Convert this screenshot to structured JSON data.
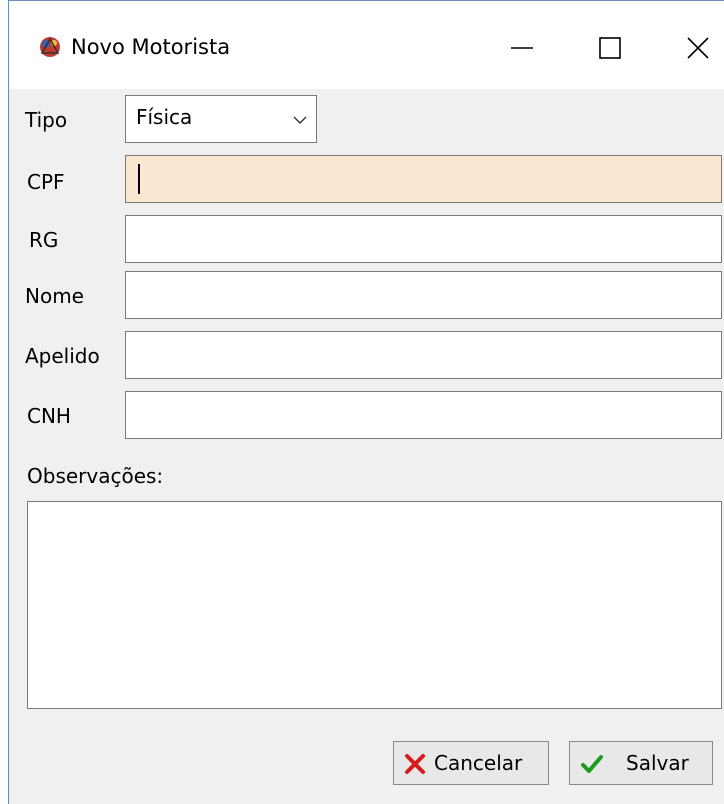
{
  "window": {
    "title": "Novo Motorista",
    "icon": "driver-app-icon",
    "controls": [
      "minimize-icon",
      "maximize-icon",
      "close-icon"
    ]
  },
  "form": {
    "tipo": {
      "label": "Tipo",
      "value": "Física"
    },
    "cpf": {
      "label": "CPF",
      "value": ""
    },
    "rg": {
      "label": "RG",
      "value": ""
    },
    "nome": {
      "label": "Nome",
      "value": ""
    },
    "apelido": {
      "label": "Apelido",
      "value": ""
    },
    "cnh": {
      "label": "CNH",
      "value": ""
    },
    "observacoes": {
      "label": "Observações:",
      "value": ""
    }
  },
  "buttons": {
    "cancel_label": "Cancelar",
    "cancel_icon": "x-icon",
    "save_label": "Salvar",
    "save_icon": "check-icon"
  },
  "colors": {
    "focused_field": "#fbe6d2",
    "cancel_icon": "#d81b1b",
    "save_icon": "#1e9a1e"
  }
}
